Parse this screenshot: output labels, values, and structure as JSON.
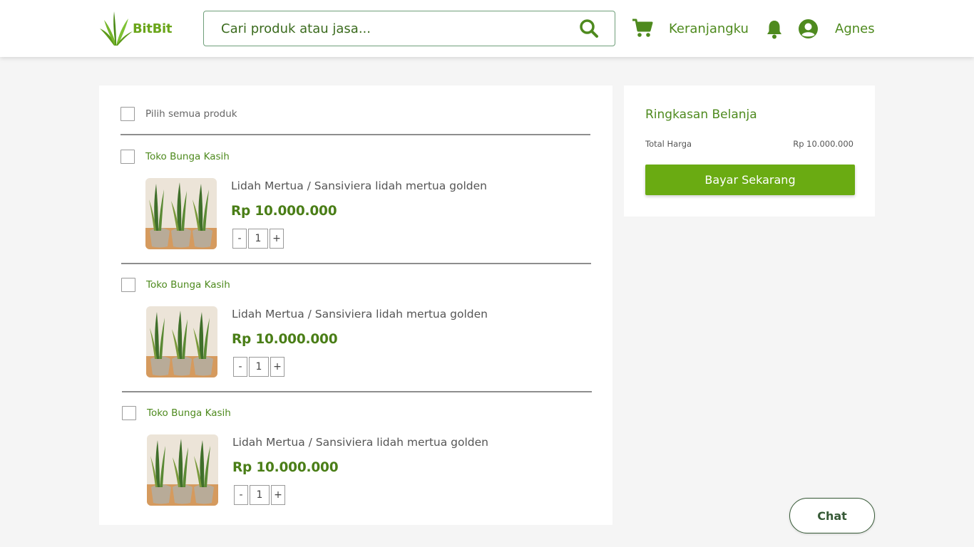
{
  "header": {
    "brand": "BitBit",
    "search_placeholder": "Cari produk atau jasa...",
    "cart_label": "Keranjangku",
    "user_name": "Agnes"
  },
  "cart": {
    "select_all_label": "Pilih semua produk",
    "items": [
      {
        "shop": "Toko Bunga Kasih",
        "product": "Lidah Mertua / Sansiviera lidah mertua golden",
        "price": "Rp 10.000.000",
        "quantity": "1"
      },
      {
        "shop": "Toko Bunga Kasih",
        "product": "Lidah Mertua / Sansiviera lidah mertua golden",
        "price": "Rp 10.000.000",
        "quantity": "1"
      },
      {
        "shop": "Toko Bunga Kasih",
        "product": "Lidah Mertua / Sansiviera lidah mertua golden",
        "price": "Rp 10.000.000",
        "quantity": "1"
      }
    ],
    "minus_label": "-",
    "plus_label": "+"
  },
  "summary": {
    "title": "Ringkasan Belanja",
    "total_label": "Total Harga",
    "total_value": "Rp 10.000.000",
    "pay_button": "Bayar Sekarang"
  },
  "chat_button": "Chat",
  "icons": {
    "logo": "leaf-logo-icon",
    "search": "search-icon",
    "cart": "shopping-cart-icon",
    "notifications": "bell-icon",
    "user": "user-avatar-icon"
  },
  "colors": {
    "brand_green": "#6aab12",
    "text_green": "#4e8a1e",
    "price_green": "#4a7e17",
    "chat_border": "#375a37"
  }
}
